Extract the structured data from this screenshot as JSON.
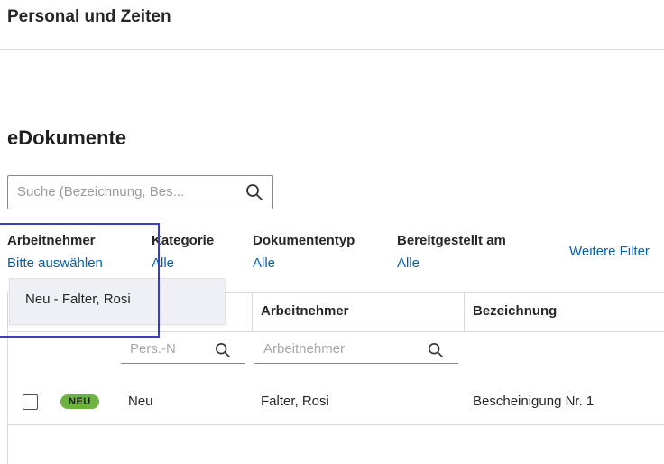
{
  "app": {
    "title": "Personal und Zeiten"
  },
  "section": {
    "title": "eDokumente"
  },
  "search": {
    "placeholder": "Suche (Bezeichnung, Bes..."
  },
  "filters": [
    {
      "label": "Arbeitnehmer",
      "value": "Bitte auswählen"
    },
    {
      "label": "Kategorie",
      "value": "Alle"
    },
    {
      "label": "Dokumententyp",
      "value": "Alle"
    },
    {
      "label": "Bereitgestellt am",
      "value": "Alle"
    }
  ],
  "more_filters": "Weitere Filter",
  "dropdown": {
    "items": [
      "Neu - Falter, Rosi"
    ]
  },
  "table": {
    "columns": [
      "Arbeitnehmer",
      "Bezeichnung"
    ],
    "filter_inputs": {
      "pers_placeholder": "Pers.-N",
      "arbeitnehmer_placeholder": "Arbeitnehmer"
    },
    "rows": [
      {
        "badge": "NEU",
        "pers_nr": "Neu",
        "arbeitnehmer": "Falter, Rosi",
        "bezeichnung": "Bescheinigung Nr. 1"
      }
    ]
  },
  "colors": {
    "link": "#0a5ea8",
    "badge": "#6cb33f",
    "highlight": "#3a3fc0"
  }
}
